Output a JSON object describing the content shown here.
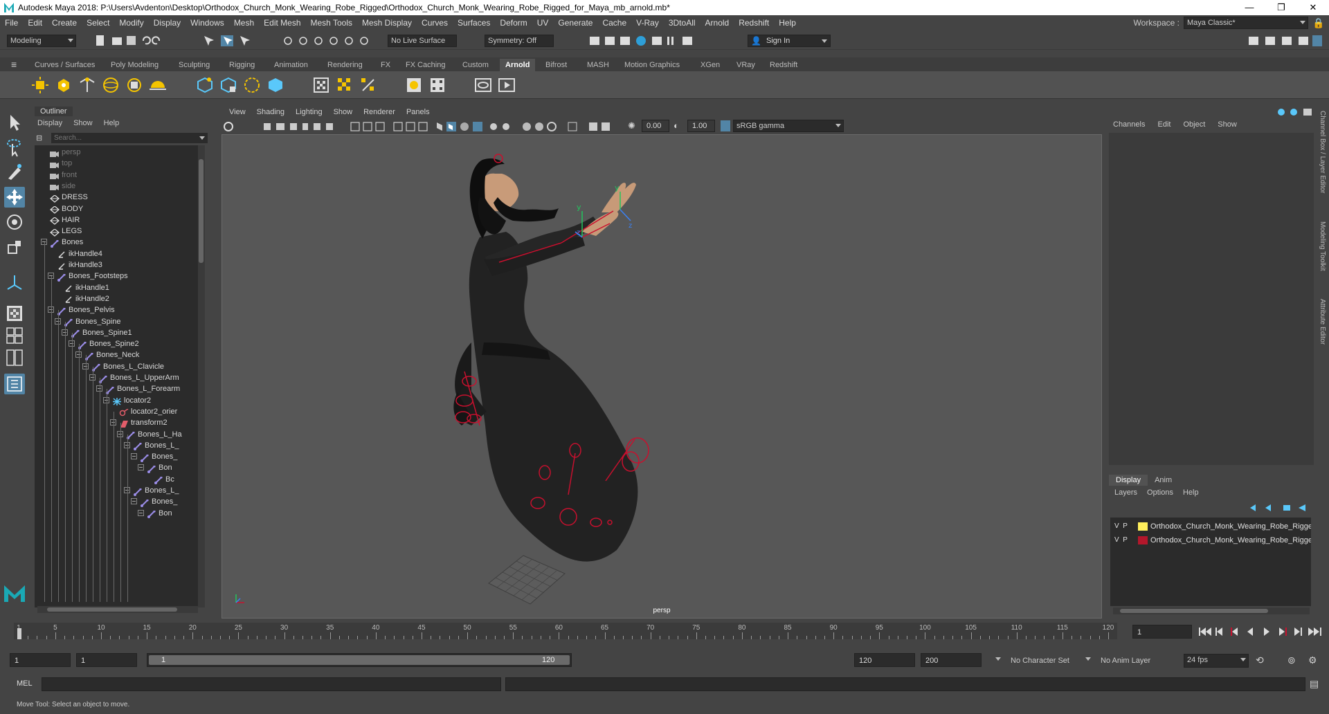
{
  "window": {
    "title": "Autodesk Maya 2018: P:\\Users\\Avdenton\\Desktop\\Orthodox_Church_Monk_Wearing_Robe_Rigged\\Orthodox_Church_Monk_Wearing_Robe_Rigged_for_Maya_mb_arnold.mb*",
    "controls": [
      "—",
      "❐",
      "✕"
    ]
  },
  "menubar": {
    "items": [
      "File",
      "Edit",
      "Create",
      "Select",
      "Modify",
      "Display",
      "Windows",
      "Mesh",
      "Edit Mesh",
      "Mesh Tools",
      "Mesh Display",
      "Curves",
      "Surfaces",
      "Deform",
      "UV",
      "Generate",
      "Cache",
      "V-Ray",
      "3DtoAll",
      "Arnold",
      "Redshift",
      "Help"
    ],
    "workspace_label": "Workspace :",
    "workspace_value": "Maya Classic*"
  },
  "statusline": {
    "mode": "Modeling",
    "live_surface": "No Live Surface",
    "symmetry": "Symmetry: Off",
    "sign_in": "Sign In"
  },
  "shelf": {
    "tabs": [
      "Curves / Surfaces",
      "Poly Modeling",
      "Sculpting",
      "Rigging",
      "Animation",
      "Rendering",
      "FX",
      "FX Caching",
      "Custom",
      "Arnold",
      "Bifrost",
      "MASH",
      "Motion Graphics",
      "XGen",
      "VRay",
      "Redshift"
    ],
    "active_tab": "Arnold"
  },
  "outliner": {
    "title": "Outliner",
    "menu": [
      "Display",
      "Show",
      "Help"
    ],
    "search_placeholder": "Search...",
    "rows": [
      {
        "label": "persp",
        "icon": "camera",
        "depth": 0,
        "dim": true
      },
      {
        "label": "top",
        "icon": "camera",
        "depth": 0,
        "dim": true
      },
      {
        "label": "front",
        "icon": "camera",
        "depth": 0,
        "dim": true
      },
      {
        "label": "side",
        "icon": "camera",
        "depth": 0,
        "dim": true
      },
      {
        "label": "DRESS",
        "icon": "mesh",
        "depth": 0
      },
      {
        "label": "BODY",
        "icon": "mesh",
        "depth": 0
      },
      {
        "label": "HAIR",
        "icon": "mesh",
        "depth": 0
      },
      {
        "label": "LEGS",
        "icon": "mesh",
        "depth": 0
      },
      {
        "label": "Bones",
        "icon": "joint",
        "depth": 0,
        "expander": true
      },
      {
        "label": "ikHandle4",
        "icon": "ik",
        "depth": 1
      },
      {
        "label": "ikHandle3",
        "icon": "ik",
        "depth": 1
      },
      {
        "label": "Bones_Footsteps",
        "icon": "joint",
        "depth": 1,
        "expander": true
      },
      {
        "label": "ikHandle1",
        "icon": "ik",
        "depth": 2
      },
      {
        "label": "ikHandle2",
        "icon": "ik",
        "depth": 2
      },
      {
        "label": "Bones_Pelvis",
        "icon": "joint",
        "depth": 1,
        "expander": true
      },
      {
        "label": "Bones_Spine",
        "icon": "joint",
        "depth": 2,
        "expander": true
      },
      {
        "label": "Bones_Spine1",
        "icon": "joint",
        "depth": 3,
        "expander": true
      },
      {
        "label": "Bones_Spine2",
        "icon": "joint",
        "depth": 4,
        "expander": true
      },
      {
        "label": "Bones_Neck",
        "icon": "joint",
        "depth": 5,
        "expander": true
      },
      {
        "label": "Bones_L_Clavicle",
        "icon": "joint",
        "depth": 6,
        "expander": true
      },
      {
        "label": "Bones_L_UpperArm",
        "icon": "joint",
        "depth": 7,
        "expander": true
      },
      {
        "label": "Bones_L_Forearm",
        "icon": "joint",
        "depth": 8,
        "expander": true
      },
      {
        "label": "locator2",
        "icon": "locator",
        "depth": 9,
        "expander": true
      },
      {
        "label": "locator2_orier",
        "icon": "constraint",
        "depth": 10
      },
      {
        "label": "transform2",
        "icon": "transform",
        "depth": 10,
        "expander": true
      },
      {
        "label": "Bones_L_Ha",
        "icon": "joint",
        "depth": 11,
        "expander": true
      },
      {
        "label": "Bones_L_",
        "icon": "joint",
        "depth": 12,
        "expander": true
      },
      {
        "label": "Bones_",
        "icon": "joint",
        "depth": 13,
        "expander": true
      },
      {
        "label": "Bon",
        "icon": "joint",
        "depth": 14,
        "expander": true
      },
      {
        "label": "Bc",
        "icon": "joint",
        "depth": 15
      },
      {
        "label": "Bones_L_",
        "icon": "joint",
        "depth": 12,
        "expander": true
      },
      {
        "label": "Bones_",
        "icon": "joint",
        "depth": 13,
        "expander": true
      },
      {
        "label": "Bon",
        "icon": "joint",
        "depth": 14,
        "expander": true
      }
    ]
  },
  "viewport": {
    "menu": [
      "View",
      "Shading",
      "Lighting",
      "Show",
      "Renderer",
      "Panels"
    ],
    "exposure": "0.00",
    "gamma": "1.00",
    "color_space": "sRGB gamma",
    "camera_label": "persp",
    "axis_labels": {
      "x": "x",
      "y": "y",
      "z": "z"
    }
  },
  "channelbox": {
    "menu": [
      "Channels",
      "Edit",
      "Object",
      "Show"
    ],
    "side_tabs": [
      "Channel Box / Layer Editor",
      "Modeling Toolkit",
      "Attribute Editor"
    ]
  },
  "layers": {
    "tabs": [
      "Display",
      "Anim"
    ],
    "active_tab": "Display",
    "menu": [
      "Layers",
      "Options",
      "Help"
    ],
    "rows": [
      {
        "v": "V",
        "p": "P",
        "color": "#ffef5c",
        "name": "Orthodox_Church_Monk_Wearing_Robe_Rigged"
      },
      {
        "v": "V",
        "p": "P",
        "color": "#b3172b",
        "name": "Orthodox_Church_Monk_Wearing_Robe_Rigged"
      }
    ]
  },
  "timeline": {
    "ticks": [
      "1",
      "5",
      "10",
      "15",
      "20",
      "25",
      "30",
      "35",
      "40",
      "45",
      "50",
      "55",
      "60",
      "65",
      "70",
      "75",
      "80",
      "85",
      "90",
      "95",
      "100",
      "105",
      "110",
      "115",
      "120"
    ],
    "current_frame": "1",
    "start": 1,
    "end": 120
  },
  "range": {
    "start_field": "1",
    "playback_start": "1",
    "slider_start": "1",
    "slider_end": "120",
    "playback_end": "120",
    "end_field": "200",
    "character_set": "No Character Set",
    "anim_layer": "No Anim Layer",
    "fps": "24 fps"
  },
  "command": {
    "label": "MEL"
  },
  "help_line": "Move Tool: Select an object to move.",
  "colors": {
    "panel": "#444444",
    "dark_field": "#2b2b2b",
    "viewport_bg": "#575757",
    "rig_red": "#c8102e",
    "active_tool_blue": "#5285a6"
  }
}
